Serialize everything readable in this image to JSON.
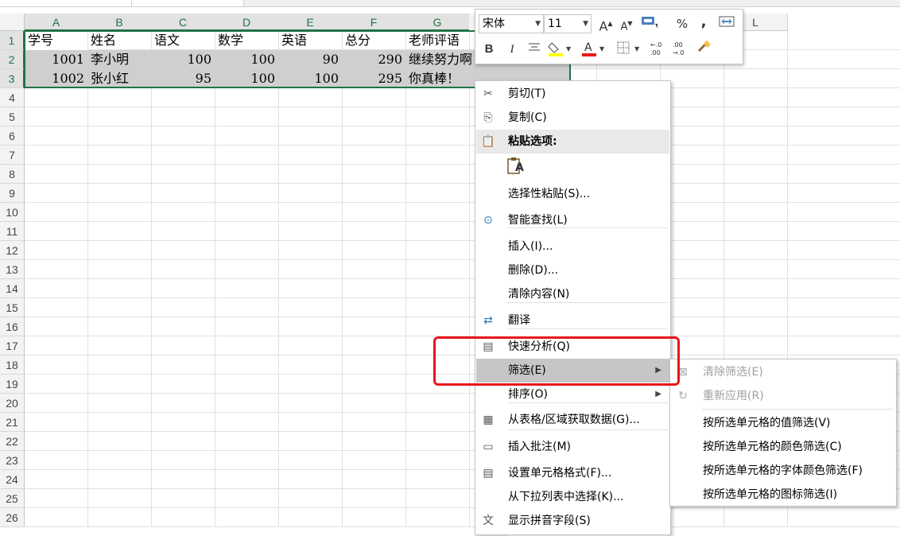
{
  "columns": [
    "A",
    "B",
    "C",
    "D",
    "E",
    "F",
    "G",
    "H",
    "I",
    "J",
    "K",
    "L"
  ],
  "rows": [
    "1",
    "2",
    "3",
    "4",
    "5",
    "6",
    "7",
    "8",
    "9",
    "10",
    "11",
    "12",
    "13",
    "14",
    "15",
    "16",
    "17",
    "18",
    "19",
    "20",
    "21",
    "22",
    "23",
    "24",
    "25",
    "26"
  ],
  "sheet": {
    "headers": [
      "学号",
      "姓名",
      "语文",
      "数学",
      "英语",
      "总分",
      "老师评语"
    ],
    "records": [
      [
        "1001",
        "李小明",
        "100",
        "100",
        "90",
        "290",
        "继续努力啊"
      ],
      [
        "1002",
        "张小红",
        "95",
        "100",
        "100",
        "295",
        "你真棒！"
      ]
    ]
  },
  "mini_toolbar": {
    "font_name": "宋体",
    "font_size": "11",
    "grow_font": "A",
    "shrink_font": "A",
    "percent": "%",
    "comma": ",",
    "bold": "B",
    "italic": "I",
    "font_color_letter": "A",
    "inc_decimal": "←.0 .00",
    "dec_decimal": ".00 →.0"
  },
  "context_menu": {
    "items": [
      {
        "label": "剪切(T)",
        "icon": "scissors-icon"
      },
      {
        "label": "复制(C)",
        "icon": "copy-icon"
      },
      {
        "label": "粘贴选项:",
        "icon": "paste-icon"
      },
      {
        "label": "选择性粘贴(S)...",
        "icon": ""
      },
      {
        "label": "智能查找(L)",
        "icon": "smart-lookup-icon"
      },
      {
        "label": "插入(I)...",
        "icon": ""
      },
      {
        "label": "删除(D)...",
        "icon": ""
      },
      {
        "label": "清除内容(N)",
        "icon": ""
      },
      {
        "label": "翻译",
        "icon": "translate-icon"
      },
      {
        "label": "快速分析(Q)",
        "icon": "quick-analysis-icon"
      },
      {
        "label": "筛选(E)",
        "icon": ""
      },
      {
        "label": "排序(O)",
        "icon": ""
      },
      {
        "label": "从表格/区域获取数据(G)...",
        "icon": "table-icon"
      },
      {
        "label": "插入批注(M)",
        "icon": "comment-icon"
      },
      {
        "label": "设置单元格格式(F)...",
        "icon": "format-cells-icon"
      },
      {
        "label": "从下拉列表中选择(K)...",
        "icon": ""
      },
      {
        "label": "显示拼音字段(S)",
        "icon": "phonetic-icon"
      }
    ],
    "paste_option_letter": "A"
  },
  "filter_submenu": {
    "items": [
      {
        "label": "清除筛选(E)",
        "enabled": false
      },
      {
        "label": "重新应用(R)",
        "enabled": false
      },
      {
        "label": "按所选单元格的值筛选(V)",
        "enabled": true
      },
      {
        "label": "按所选单元格的颜色筛选(C)",
        "enabled": true
      },
      {
        "label": "按所选单元格的字体颜色筛选(F)",
        "enabled": true
      },
      {
        "label": "按所选单元格的图标筛选(I)",
        "enabled": true
      }
    ]
  },
  "colors": {
    "accent": "#217346",
    "highlight_box": "#e8161b",
    "font_color": "#e81c1c",
    "fill_color": "#ffff00"
  }
}
